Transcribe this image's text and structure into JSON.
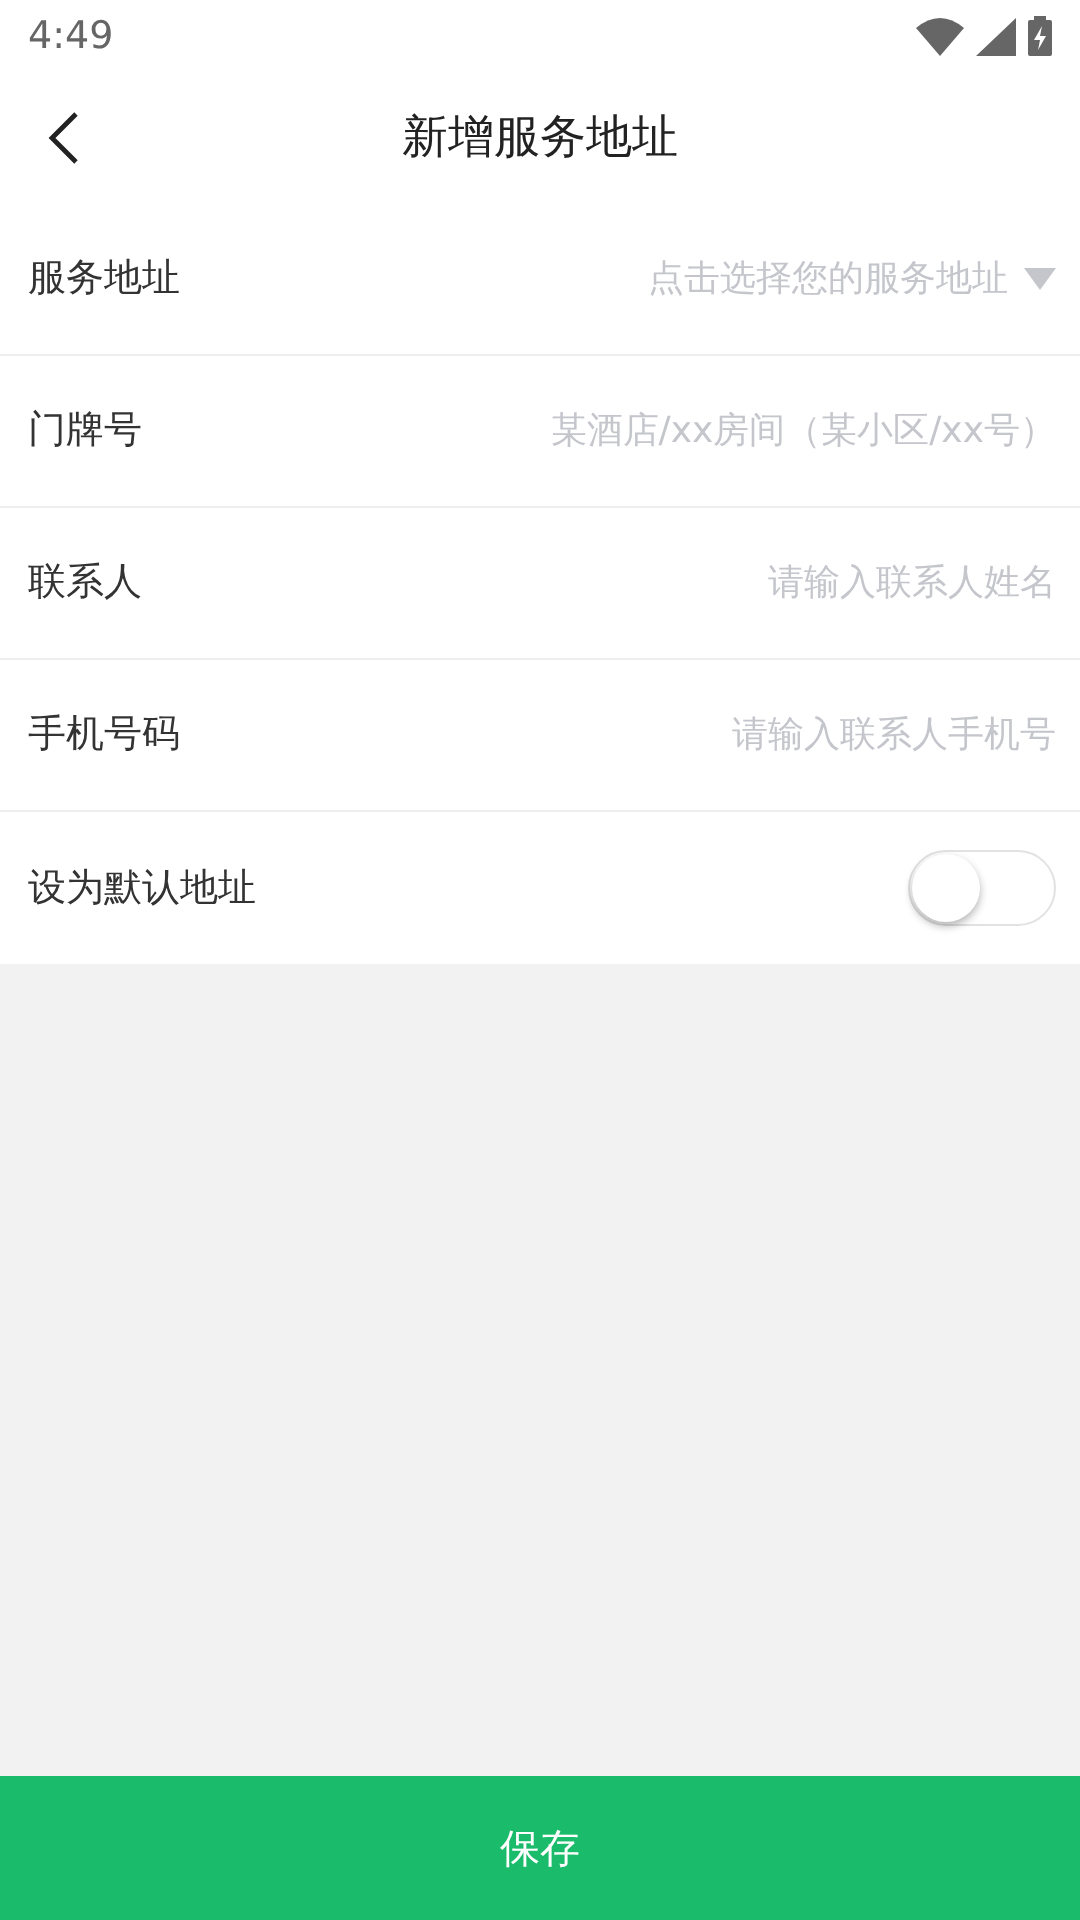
{
  "status_bar": {
    "time": "4:49"
  },
  "header": {
    "title": "新增服务地址"
  },
  "form": {
    "rows": [
      {
        "kind": "select",
        "label": "服务地址",
        "placeholder": "点击选择您的服务地址"
      },
      {
        "kind": "input",
        "label": "门牌号",
        "placeholder": "某酒店/xx房间（某小区/xx号）"
      },
      {
        "kind": "input",
        "label": "联系人",
        "placeholder": "请输入联系人姓名"
      },
      {
        "kind": "input",
        "label": "手机号码",
        "placeholder": "请输入联系人手机号"
      },
      {
        "kind": "switch",
        "label": "设为默认地址",
        "on": false
      }
    ]
  },
  "save_button": {
    "label": "保存"
  }
}
